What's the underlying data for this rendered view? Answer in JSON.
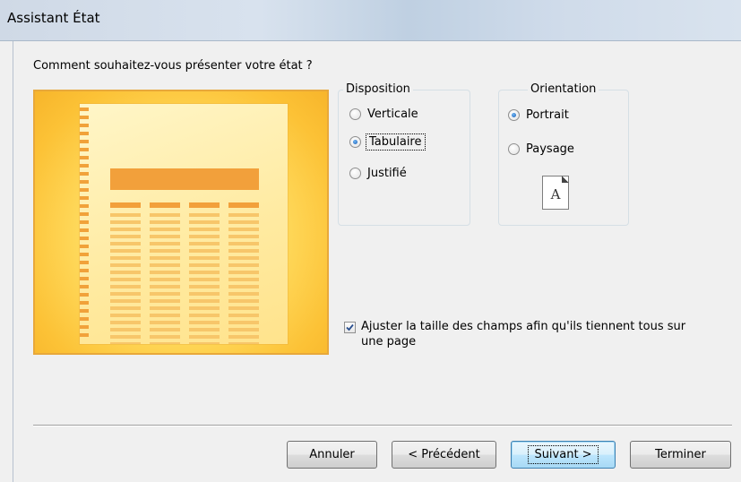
{
  "window": {
    "title": "Assistant État"
  },
  "prompt": "Comment souhaitez-vous présenter votre état ?",
  "disposition": {
    "legend": "Disposition",
    "options": [
      {
        "label": "Verticale",
        "selected": false
      },
      {
        "label": "Tabulaire",
        "selected": true
      },
      {
        "label": "Justifié",
        "selected": false
      }
    ]
  },
  "orientation": {
    "legend": "Orientation",
    "options": [
      {
        "label": "Portrait",
        "selected": true
      },
      {
        "label": "Paysage",
        "selected": false
      }
    ],
    "icon_letter": "A"
  },
  "fit_checkbox": {
    "label": "Ajuster la taille des champs afin qu'ils tiennent tous sur une page",
    "checked": true
  },
  "buttons": {
    "cancel": "Annuler",
    "previous": "< Précédent",
    "next": "Suivant >",
    "finish": "Terminer"
  },
  "colors": {
    "preview_orange": "#f2a03b",
    "preview_yellow": "#ffdc60",
    "default_button_border": "#3c7fb1"
  }
}
